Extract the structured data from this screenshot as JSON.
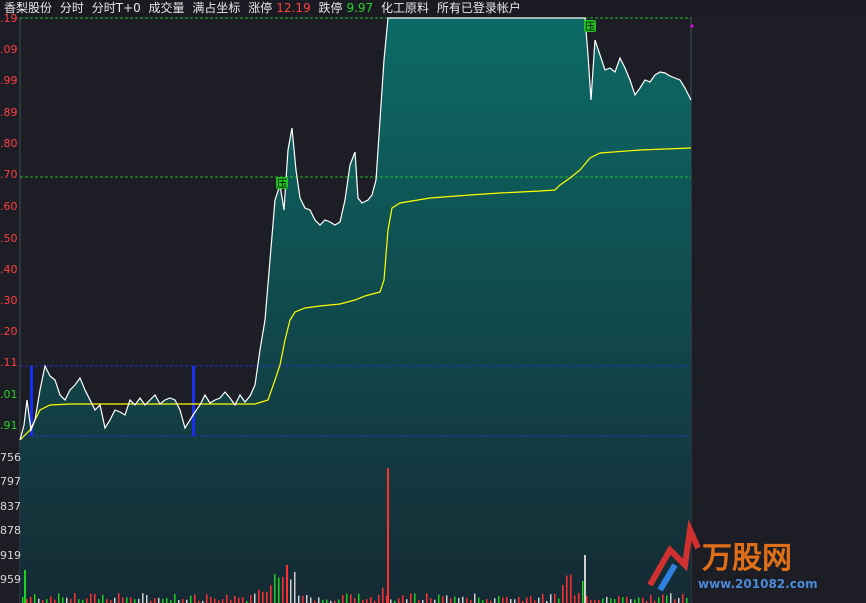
{
  "header": {
    "stock_name": "香梨股份",
    "tab_intraday": "分时",
    "tab_t0": "分时T+0",
    "tab_volume": "成交量",
    "tab_full_coord": "满占坐标",
    "limit_up_label": "涨停",
    "limit_up_value": "12.19",
    "limit_down_label": "跌停",
    "limit_down_value": "9.97",
    "sector": "化工原料",
    "accounts": "所有已登录帐户"
  },
  "price_axis_labels": [
    ".19",
    ".09",
    ".99",
    ".89",
    ".80",
    ".70",
    ".60",
    ".50",
    ".40",
    ".30",
    ".20",
    ".11",
    ".01",
    ".91"
  ],
  "volume_axis_labels": [
    "756",
    "797",
    "837",
    "878",
    "919",
    "959"
  ],
  "markers": [
    {
      "label": "压"
    },
    {
      "label": "压"
    }
  ],
  "watermark": {
    "brand": "万股网",
    "url": "www.201082.com"
  },
  "colors": {
    "background": "#1c1d25",
    "price_line": "#ffffff",
    "avg_line": "#ffff00",
    "area_top": "#0c6a66",
    "limit_line": "#22c022",
    "blue_line": "#2233cc",
    "up": "#ff3030",
    "down": "#20d020"
  }
}
